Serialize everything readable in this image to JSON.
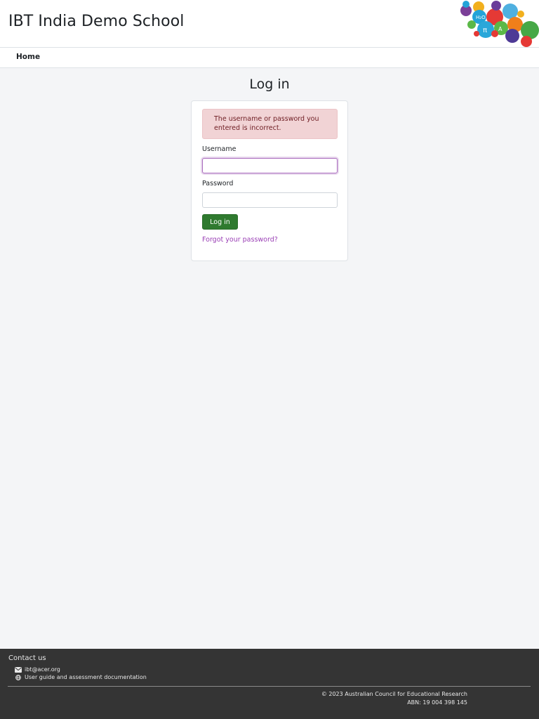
{
  "site": {
    "title": "IBT India Demo School",
    "logo_icon": "science-bubbles-logo"
  },
  "nav": {
    "home_label": "Home"
  },
  "login": {
    "heading": "Log in",
    "error_message": "The username or password you entered is incorrect.",
    "username_label": "Username",
    "username_value": "",
    "password_label": "Password",
    "password_value": "",
    "submit_label": "Log in",
    "forgot_label": "Forgot your password?"
  },
  "footer": {
    "contact_heading": "Contact us",
    "email": "ibt@acer.org",
    "email_icon": "envelope-icon",
    "docs_link": "User guide and assessment documentation",
    "docs_icon": "globe-icon",
    "copyright": "© 2023 Australian Council for Educational Research",
    "abn": "ABN: 19 004 398 145"
  },
  "colors": {
    "page_background": "#f4f5f7",
    "login_button": "#2f7a2f",
    "alert_background": "#f1d3d5",
    "link": "#9a3fb5",
    "footer_background": "#343434"
  }
}
